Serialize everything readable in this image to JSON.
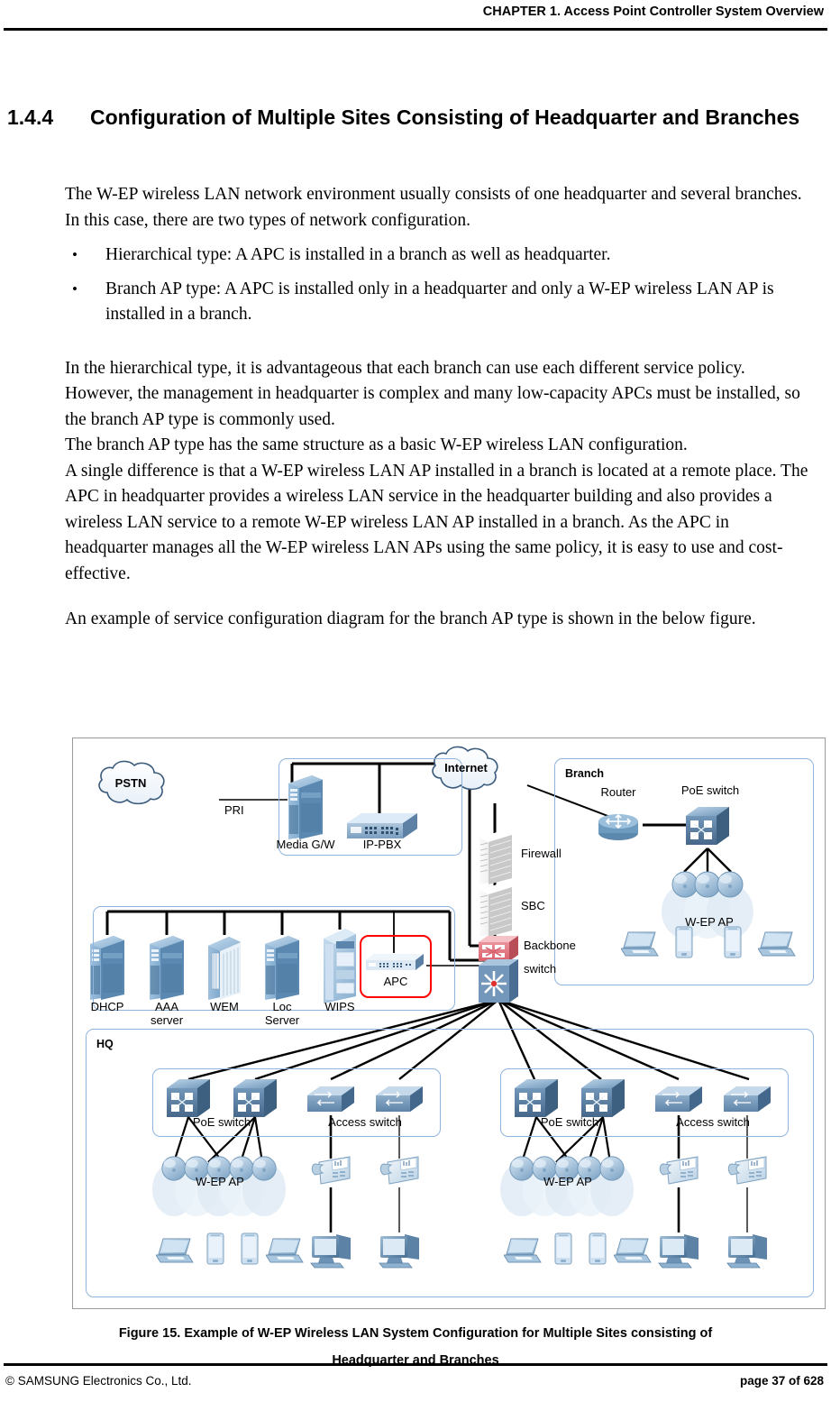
{
  "header": {
    "chapter": "CHAPTER 1. Access Point Controller System Overview"
  },
  "section": {
    "number": "1.4.4",
    "title": "Configuration of Multiple Sites Consisting of Headquarter and Branches"
  },
  "body": {
    "para1_line1": "The W-EP wireless LAN network environment usually consists of one headquarter and several branches.",
    "para1_line2": "In this case, there are two types of network configuration.",
    "bullet_char": "•",
    "bullets": [
      "Hierarchical type: A APC is installed in a branch as well as headquarter.",
      "Branch AP type: A APC is installed only in a headquarter and only a W-EP wireless LAN AP is installed in a branch."
    ],
    "para2": "In the hierarchical type, it is advantageous that each branch can use each different service policy. However, the management in headquarter is complex and many low-capacity APCs must be installed, so the branch AP type is commonly used.",
    "para3": "The branch AP type has the same structure as a basic W-EP wireless LAN configuration.",
    "para4": "A single difference is that a W-EP wireless LAN AP installed in a branch is located at a remote place. The APC in headquarter provides a wireless LAN service in the headquarter building and also provides a wireless LAN service to a remote W-EP wireless LAN AP installed in a branch. As the APC in headquarter manages all the W-EP wireless LAN APs using the same policy, it is easy to use and cost-effective.",
    "para5": "An example of service configuration diagram for the branch AP type is shown in the below figure."
  },
  "figure": {
    "caption_line1": "Figure 15. Example of W-EP Wireless LAN System Configuration for Multiple Sites consisting of",
    "caption_line2": "Headquarter and Branches",
    "nodes": {
      "pstn": "PSTN",
      "pri": "PRI",
      "media_gw": "Media G/W",
      "ip_pbx": "IP-PBX",
      "internet": "Internet",
      "firewall": "Firewall",
      "sbc": "SBC",
      "backbone_line1": "Backbone",
      "backbone_line2": "switch",
      "dhcp": "DHCP",
      "aaa_line1": "AAA",
      "aaa_line2": "server",
      "wem": "WEM",
      "loc_line1": "Loc",
      "loc_line2": "Server",
      "wips": "WIPS",
      "apc": "APC",
      "branch": "Branch",
      "router": "Router",
      "poe_switch": "PoE switch",
      "wep_ap": "W-EP AP",
      "hq": "HQ",
      "access_switch": "Access switch"
    },
    "colors": {
      "box_border": "#8fb4dd",
      "frame_border": "#9a9a9a",
      "device_blue": "#7ea7cc",
      "device_blue_dark": "#4f7fa8",
      "backbone_red": "#e8737d",
      "apc_highlight": "#ff0000",
      "wire": "#000000"
    }
  },
  "footer": {
    "left": "© SAMSUNG Electronics Co., Ltd.",
    "right": "page 37 of 628"
  }
}
